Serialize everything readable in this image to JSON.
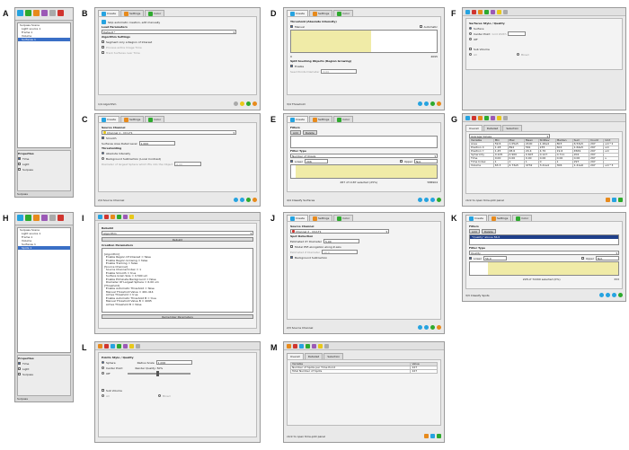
{
  "labels": [
    "A",
    "B",
    "C",
    "D",
    "E",
    "F",
    "G",
    "H",
    "I",
    "J",
    "K",
    "L",
    "M"
  ],
  "tabs": {
    "create": "Create",
    "settings": "Settings",
    "color": "Color"
  },
  "colors": {
    "nav_green": "#2eaa2e",
    "nav_blue": "#26a3e0",
    "hist_fill": "#f0eba7",
    "frame": "#e9e9e9"
  },
  "B": {
    "skip": "Skip automatic creation, edit manually",
    "load_params": "Load Parameters",
    "load_value": "Default *",
    "algo_settings": "Algorithm Settings",
    "opt1": "Segment only a Region of Interest",
    "opt2": "Process entire Image Time",
    "opt3": "Track Surfaces over Time",
    "step": "1/4 Algorithm"
  },
  "C": {
    "source_channel": "Source Channel",
    "channel": "Channel 1 - Ch1-T1",
    "smooth": "Smooth",
    "grain_label": "Surfaces Area Detail Level",
    "grain_value": "1.000",
    "thresholding": "Thresholding",
    "abs": "Absolute Intensity",
    "bg": "Background Subtraction (Local Contrast)",
    "diam_label": "Diameter of largest Sphere which fits into the Object",
    "diam_value": "6.00",
    "step": "2/4 Source Channel"
  },
  "D": {
    "title": "Threshold (Absolute Intensity)",
    "manual": "Manual",
    "auto": "Automatic",
    "min": "0",
    "max": "4095",
    "split": "Split touching Objects (Region Growing)",
    "enable": "Enable",
    "seed_label": "Seed Points Diameter",
    "seed_value": "3.00",
    "step": "3/4 Threshold"
  },
  "E": {
    "filters": "Filters",
    "add": "Add",
    "delete": "Delete",
    "filter_type": "Filter Type",
    "filter_value": "Number of Voxels",
    "lower": "Lower",
    "lower_value": "206",
    "upper": "Upper",
    "upper_value": "N/A",
    "count": "287 of 1187 selected (25%)",
    "max": "588904",
    "step": "4/4 Classify Surfaces"
  },
  "F": {
    "title": "Surfaces Style / Quality",
    "opt_surface": "Surface",
    "opt_center": "Center Point",
    "opt_off": "Off",
    "sub_volume": "Sub Volume",
    "grid_label": "Grid Width",
    "radio_all": "All",
    "radio_mixed": "Mixed"
  },
  "G": {
    "tabs": [
      "Overall",
      "Detailed",
      "Selection"
    ],
    "dropdown": "Average Values",
    "headers": [
      "Variable",
      "Min",
      "Max",
      "Mean",
      "StdDev",
      "Median",
      "Sum",
      "Count",
      "Unit"
    ],
    "rows": [
      [
        "Area",
        "59.6",
        "1.05e5",
        "2100",
        "1.26e4",
        "803",
        "6.53e5",
        "297",
        "um^2"
      ],
      [
        "Position X",
        "1.28",
        "892",
        "561",
        "235",
        "602",
        "1.64e5",
        "297",
        "um"
      ],
      [
        "Position Y",
        "1.45",
        "28.6",
        "20.4",
        "4.70",
        "19.6",
        "4569",
        "297",
        "um"
      ],
      [
        "Sphericity",
        "0.105",
        "0.900",
        "0.607",
        "0.127",
        "0.711",
        "204",
        "297",
        ""
      ],
      [
        "Time",
        "0.00",
        "0.00",
        "0.00",
        "0.00",
        "0.00",
        "0.00",
        "297",
        "s"
      ],
      [
        "Time Index",
        "1",
        "1",
        "1",
        "0",
        "1",
        "297",
        "297",
        ""
      ],
      [
        "Volume",
        "63.3",
        "4.73e5",
        "4732",
        "3.41e4",
        "306",
        "1.41e6",
        "297",
        "um^3"
      ]
    ],
    "link": "click to open time-plot panel"
  },
  "I": {
    "rebuild": "Rebuild",
    "algorithm": "Algorithm",
    "rebuild_btn": "Rebuild",
    "creation": "Creation Parameters",
    "params": [
      "[Algorithm]",
      "  Enable Region Of Interest = false",
      "  Enable Region Growing = false",
      "  Enable Tracking = false",
      "[Source Channel]",
      "  Source Channel Index = 1",
      "  Enable Smooth = true",
      "  Surface Grain Size = 0.500 um",
      "  Enable Eliminate Background = false",
      "  Diameter Of Largest Sphere = 6.00 um",
      "[Threshold]",
      "  Enable Automatic Threshold = false",
      "  Manual Threshold Value = 461.414",
      "  Active Threshold = true",
      "  Enable Automatic Threshold B = true",
      "  Manual Threshold Value B = 4095",
      "  Active Threshold B = false"
    ],
    "remember": "Remember Parameters"
  },
  "J": {
    "source_channel": "Source Channel",
    "channel": "Channel 2 - Ch2-T1",
    "spot_detection": "Spot Detection",
    "diam_label": "Estimated XY Diameter",
    "diam_value": "5.00",
    "ellipse": "Model PSF-elongation along Z-axis",
    "z_label": "Estimated Z Diameter",
    "z_value": "10.0",
    "bg": "Background Subtraction",
    "step": "2/3 Source Channel"
  },
  "K": {
    "filters": "Filters",
    "add": "Add",
    "delete": "Delete",
    "filter_item": "\"Quality\" above 56.0",
    "filter_type": "Filter Type",
    "filter_value": "Quality",
    "lower": "Lower",
    "lower_value": "56.0",
    "upper": "Upper",
    "upper_value": "N/A",
    "count": "228 of 72200 selected (0%)",
    "max": "333",
    "step": "3/3 Classify Spots"
  },
  "L": {
    "title": "Points Style / Quality",
    "sphere": "Sphere",
    "center": "Center Point",
    "off": "Off",
    "radius_label": "Radius Scale",
    "radius_value": "1.000",
    "render_label": "Render Quality: 50%",
    "sub_volume": "Sub Volume",
    "all": "All",
    "mixed": "Mixed"
  },
  "M": {
    "tabs": [
      "Overall",
      "Detailed",
      "Selection"
    ],
    "headers": [
      "Variable",
      "Value"
    ],
    "rows": [
      [
        "Number of Spots per Time Point",
        "227"
      ],
      [
        "Total Number of Spots",
        "227"
      ]
    ],
    "link": "click to open time-plot panel"
  },
  "A": {
    "tree": [
      "Surpass Scene",
      "Light source 1",
      "Frame 1",
      "Volume",
      "Surfaces 1"
    ],
    "props": "Properties",
    "prop_items": [
      "Time",
      "Light",
      "Surpass"
    ],
    "status": "Surpass"
  },
  "H": {
    "tree": [
      "Surpass Scene",
      "Light source 1",
      "Frame 1",
      "Volume",
      "Surfaces 1",
      "Spots 1"
    ],
    "props": "Properties",
    "prop_items": [
      "Time",
      "Light",
      "Surpass"
    ],
    "status": "Surpass"
  }
}
